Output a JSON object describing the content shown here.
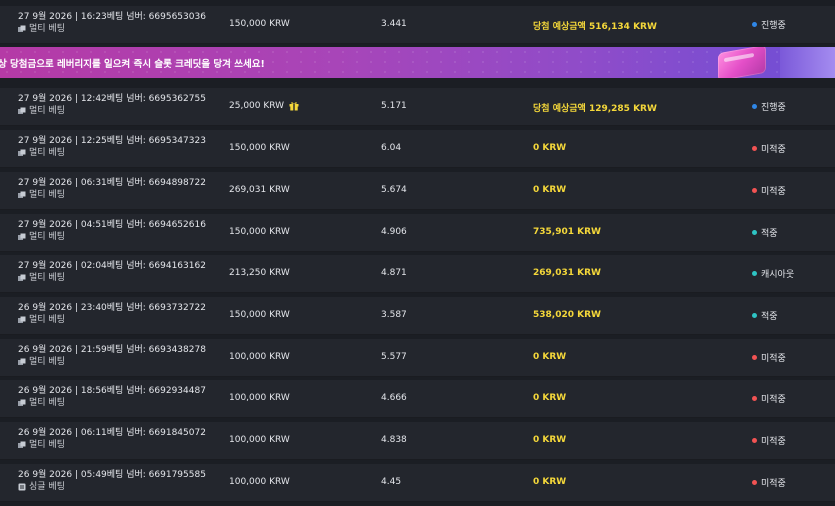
{
  "banner": {
    "text": "상 당첨금으로 레버리지를 일으켜 즉시 슬롯 크레딧을 당겨 쓰세요!"
  },
  "status_colors": {
    "진행중": "#2f86e6",
    "미적중": "#f25353",
    "적중": "#2ec4c4",
    "캐시아웃": "#2ec4c4"
  },
  "bets": [
    {
      "date": "27 9월 2026 | 16:23",
      "bet_no_label": "베팅 넘버:",
      "bet_no": "6695653036",
      "type": "멀티 베팅",
      "amount": "150,000 KRW",
      "gift": false,
      "odds": "3.441",
      "payout": "당첨 예상금액 516,134 KRW",
      "status": "진행중"
    },
    {
      "date": "27 9월 2026 | 12:42",
      "bet_no_label": "베팅 넘버:",
      "bet_no": "6695362755",
      "type": "멀티 베팅",
      "amount": "25,000 KRW",
      "gift": true,
      "odds": "5.171",
      "payout": "당첨 예상금액 129,285 KRW",
      "status": "진행중"
    },
    {
      "date": "27 9월 2026 | 12:25",
      "bet_no_label": "베팅 넘버:",
      "bet_no": "6695347323",
      "type": "멀티 베팅",
      "amount": "150,000 KRW",
      "gift": false,
      "odds": "6.04",
      "payout": "0 KRW",
      "status": "미적중"
    },
    {
      "date": "27 9월 2026 | 06:31",
      "bet_no_label": "베팅 넘버:",
      "bet_no": "6694898722",
      "type": "멀티 베팅",
      "amount": "269,031 KRW",
      "gift": false,
      "odds": "5.674",
      "payout": "0 KRW",
      "status": "미적중"
    },
    {
      "date": "27 9월 2026 | 04:51",
      "bet_no_label": "베팅 넘버:",
      "bet_no": "6694652616",
      "type": "멀티 베팅",
      "amount": "150,000 KRW",
      "gift": false,
      "odds": "4.906",
      "payout": "735,901 KRW",
      "status": "적중"
    },
    {
      "date": "27 9월 2026 | 02:04",
      "bet_no_label": "베팅 넘버:",
      "bet_no": "6694163162",
      "type": "멀티 베팅",
      "amount": "213,250 KRW",
      "gift": false,
      "odds": "4.871",
      "payout": "269,031 KRW",
      "status": "캐시아웃"
    },
    {
      "date": "26 9월 2026 | 23:40",
      "bet_no_label": "베팅 넘버:",
      "bet_no": "6693732722",
      "type": "멀티 베팅",
      "amount": "150,000 KRW",
      "gift": false,
      "odds": "3.587",
      "payout": "538,020 KRW",
      "status": "적중"
    },
    {
      "date": "26 9월 2026 | 21:59",
      "bet_no_label": "베팅 넘버:",
      "bet_no": "6693438278",
      "type": "멀티 베팅",
      "amount": "100,000 KRW",
      "gift": false,
      "odds": "5.577",
      "payout": "0 KRW",
      "status": "미적중"
    },
    {
      "date": "26 9월 2026 | 18:56",
      "bet_no_label": "베팅 넘버:",
      "bet_no": "6692934487",
      "type": "멀티 베팅",
      "amount": "100,000 KRW",
      "gift": false,
      "odds": "4.666",
      "payout": "0 KRW",
      "status": "미적중"
    },
    {
      "date": "26 9월 2026 | 06:11",
      "bet_no_label": "베팅 넘버:",
      "bet_no": "6691845072",
      "type": "멀티 베팅",
      "amount": "100,000 KRW",
      "gift": false,
      "odds": "4.838",
      "payout": "0 KRW",
      "status": "미적중"
    },
    {
      "date": "26 9월 2026 | 05:49",
      "bet_no_label": "베팅 넘버:",
      "bet_no": "6691795585",
      "type": "싱글 베팅",
      "amount": "100,000 KRW",
      "gift": false,
      "odds": "4.45",
      "payout": "0 KRW",
      "status": "미적중"
    }
  ]
}
